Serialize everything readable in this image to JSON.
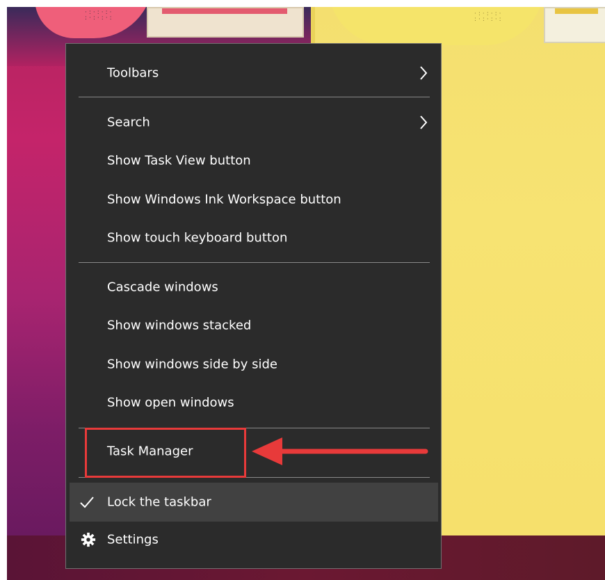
{
  "colors": {
    "menu_background": "#2b2b2b",
    "menu_border": "#707070",
    "hover_background": "#414141",
    "text": "#ffffff",
    "annotation": "#e83a3a"
  },
  "context_menu": {
    "sections": [
      {
        "items": [
          {
            "label": "Toolbars",
            "icon": "chevron-right-icon"
          }
        ]
      },
      {
        "items": [
          {
            "label": "Search",
            "icon": "chevron-right-icon"
          },
          {
            "label": "Show Task View button"
          },
          {
            "label": "Show Windows Ink Workspace button"
          },
          {
            "label": "Show touch keyboard button"
          }
        ]
      },
      {
        "items": [
          {
            "label": "Cascade windows"
          },
          {
            "label": "Show windows stacked"
          },
          {
            "label": "Show windows side by side"
          },
          {
            "label": "Show open windows"
          }
        ]
      },
      {
        "items": [
          {
            "label": "Task Manager",
            "annotated": true
          }
        ]
      },
      {
        "items": [
          {
            "label": "Lock the taskbar",
            "checked": true,
            "icon": "checkmark-icon",
            "highlighted": true
          },
          {
            "label": "Settings",
            "icon": "gear-icon"
          }
        ]
      }
    ]
  },
  "annotation": {
    "target": "Task Manager",
    "shape": "rectangle-with-left-pointing-arrow"
  }
}
